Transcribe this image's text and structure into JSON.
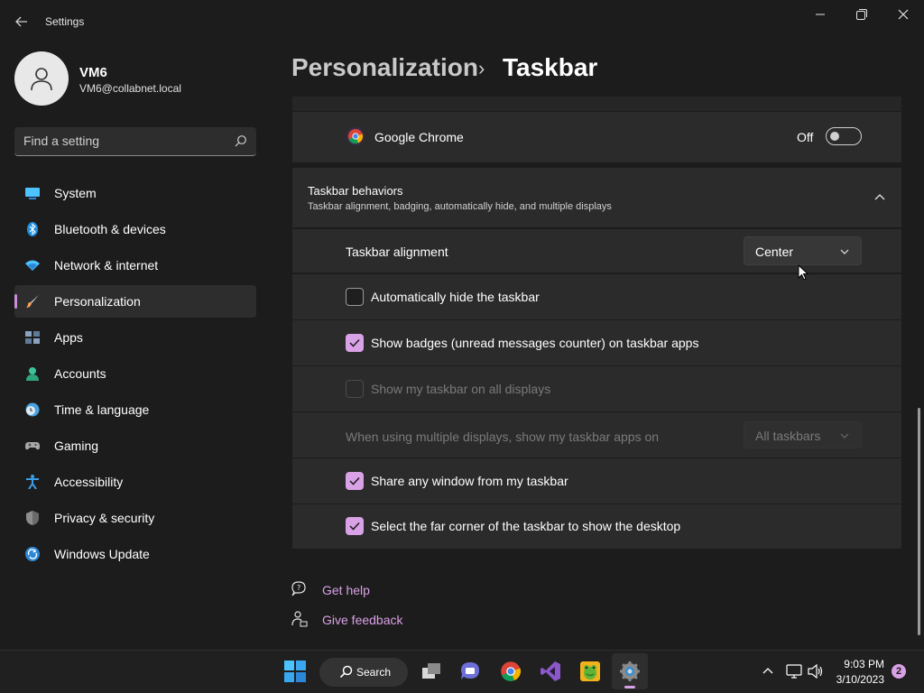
{
  "window": {
    "app_title": "Settings"
  },
  "user": {
    "name": "VM6",
    "email": "VM6@collabnet.local"
  },
  "search": {
    "placeholder": "Find a setting"
  },
  "sidebar": {
    "items": [
      {
        "label": "System",
        "icon": "system-icon"
      },
      {
        "label": "Bluetooth & devices",
        "icon": "bluetooth-icon"
      },
      {
        "label": "Network & internet",
        "icon": "wifi-icon"
      },
      {
        "label": "Personalization",
        "icon": "brush-icon",
        "selected": true
      },
      {
        "label": "Apps",
        "icon": "apps-icon"
      },
      {
        "label": "Accounts",
        "icon": "accounts-icon"
      },
      {
        "label": "Time & language",
        "icon": "clock-globe-icon"
      },
      {
        "label": "Gaming",
        "icon": "gamepad-icon"
      },
      {
        "label": "Accessibility",
        "icon": "accessibility-icon"
      },
      {
        "label": "Privacy & security",
        "icon": "shield-icon"
      },
      {
        "label": "Windows Update",
        "icon": "update-icon"
      }
    ]
  },
  "breadcrumb": {
    "parent": "Personalization",
    "separator": "›",
    "current": "Taskbar"
  },
  "chrome_row": {
    "app": "Google Chrome",
    "state_label": "Off",
    "enabled": false
  },
  "behaviors": {
    "title": "Taskbar behaviors",
    "subtitle": "Taskbar alignment, badging, automatically hide, and multiple displays",
    "alignment_label": "Taskbar alignment",
    "alignment_value": "Center",
    "auto_hide_label": "Automatically hide the taskbar",
    "auto_hide_checked": false,
    "badges_label": "Show badges (unread messages counter) on taskbar apps",
    "badges_checked": true,
    "all_displays_label": "Show my taskbar on all displays",
    "all_displays_checked": false,
    "multi_display_label": "When using multiple displays, show my taskbar apps on",
    "multi_display_value": "All taskbars",
    "share_window_label": "Share any window from my taskbar",
    "share_window_checked": true,
    "far_corner_label": "Select the far corner of the taskbar to show the desktop",
    "far_corner_checked": true
  },
  "help_links": {
    "get_help": "Get help",
    "give_feedback": "Give feedback"
  },
  "taskbar": {
    "search_label": "Search",
    "time": "9:03 PM",
    "date": "3/10/2023",
    "notification_count": "2"
  },
  "colors": {
    "accent": "#d9a1e6",
    "background": "#1c1c1c",
    "card": "#2b2b2b"
  }
}
